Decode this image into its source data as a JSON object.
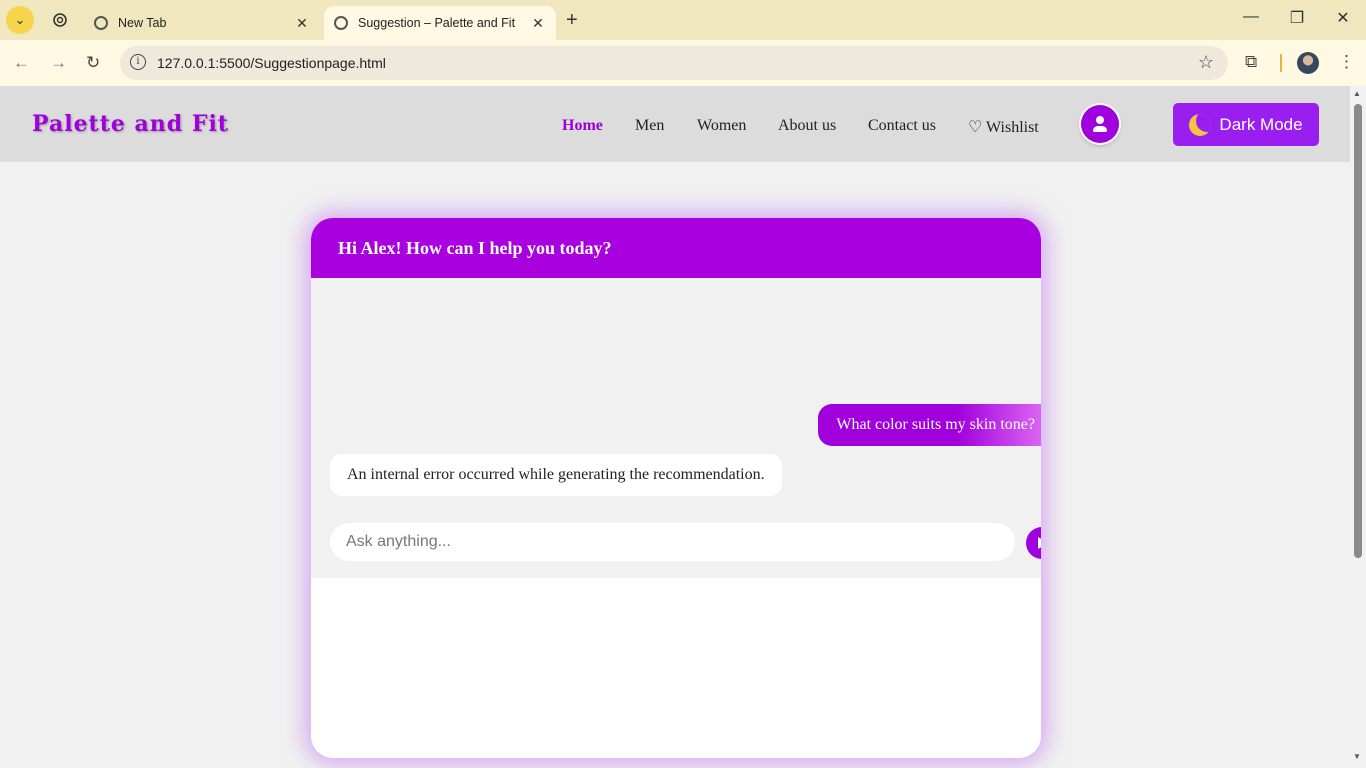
{
  "browser": {
    "tabs": [
      {
        "title": "New Tab",
        "active": false
      },
      {
        "title": "Suggestion – Palette and Fit",
        "active": true
      }
    ],
    "tab_close_glyph": "✕",
    "new_tab_glyph": "+",
    "url": "127.0.0.1:5500/Suggestionpage.html",
    "info_glyph": "i",
    "star_glyph": "☆",
    "nav": {
      "back": "←",
      "forward": "→",
      "reload": "↻"
    },
    "window": {
      "minimize": "—",
      "maximize": "❐",
      "close": "✕"
    },
    "menu_glyph": "⋮",
    "extensions_glyph": "⧉",
    "tab_search_glyph": "⌄"
  },
  "site": {
    "brand": "Palette and Fit",
    "menu": [
      {
        "label": "Home",
        "active": true
      },
      {
        "label": "Men",
        "active": false
      },
      {
        "label": "Women",
        "active": false
      },
      {
        "label": "About us",
        "active": false
      },
      {
        "label": "Contact us",
        "active": false
      },
      {
        "label": "♡ Wishlist",
        "active": false
      }
    ],
    "dark_mode_label": "Dark Mode"
  },
  "chat": {
    "header": "Hi Alex! How can I help you today?",
    "messages": [
      {
        "from": "user",
        "text": "What color suits my skin tone?"
      },
      {
        "from": "bot",
        "text": "An internal error occurred while generating the recommendation."
      }
    ],
    "input_placeholder": "Ask anything..."
  },
  "colors": {
    "brand": "#a000dc",
    "dark_mode_button": "#9b1ef0",
    "tab_bar": "#f1e7bf",
    "toolbar": "#fff8e2"
  }
}
